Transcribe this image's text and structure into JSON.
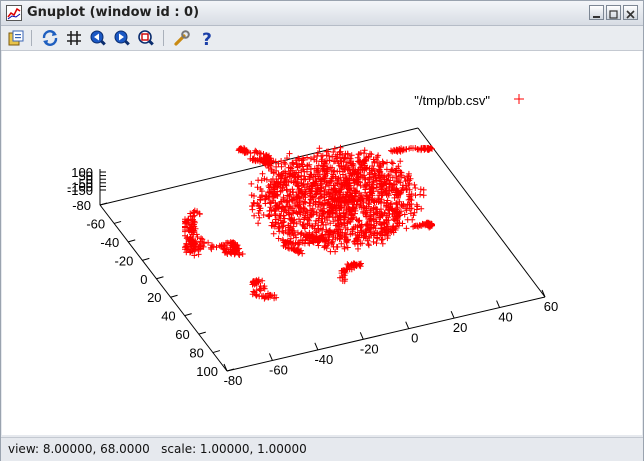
{
  "window": {
    "title": "Gnuplot (window id : 0)"
  },
  "toolbar": {
    "buttons": [
      "copy-to-clipboard",
      "replot",
      "toggle-grid",
      "previous-zoom",
      "next-zoom",
      "autoscale",
      "options",
      "help"
    ]
  },
  "legend": {
    "label": "\"/tmp/bb.csv\"",
    "color": "#ff0000"
  },
  "axes": {
    "x_ticks": [
      "-80",
      "-60",
      "-40",
      "-20",
      "0",
      "20",
      "40",
      "60"
    ],
    "y_ticks": [
      "-80",
      "-60",
      "-40",
      "-20",
      "0",
      "20",
      "40",
      "60",
      "80",
      "100"
    ],
    "z_ticks": [
      "100",
      "50",
      "0",
      "-50",
      "-100",
      "-150"
    ]
  },
  "status": {
    "text": "view: 8.00000, 68.0000   scale: 1.00000, 1.00000"
  },
  "chart_data": {
    "type": "scatter",
    "series": [
      {
        "name": "\"/tmp/bb.csv\"",
        "marker": "+",
        "color": "#ff0000"
      }
    ],
    "view": [
      8.0,
      68.0
    ],
    "scale": [
      1.0,
      1.0
    ],
    "xlim": [
      -80,
      60
    ],
    "ylim": [
      -80,
      100
    ],
    "zlim": [
      -150,
      100
    ]
  }
}
